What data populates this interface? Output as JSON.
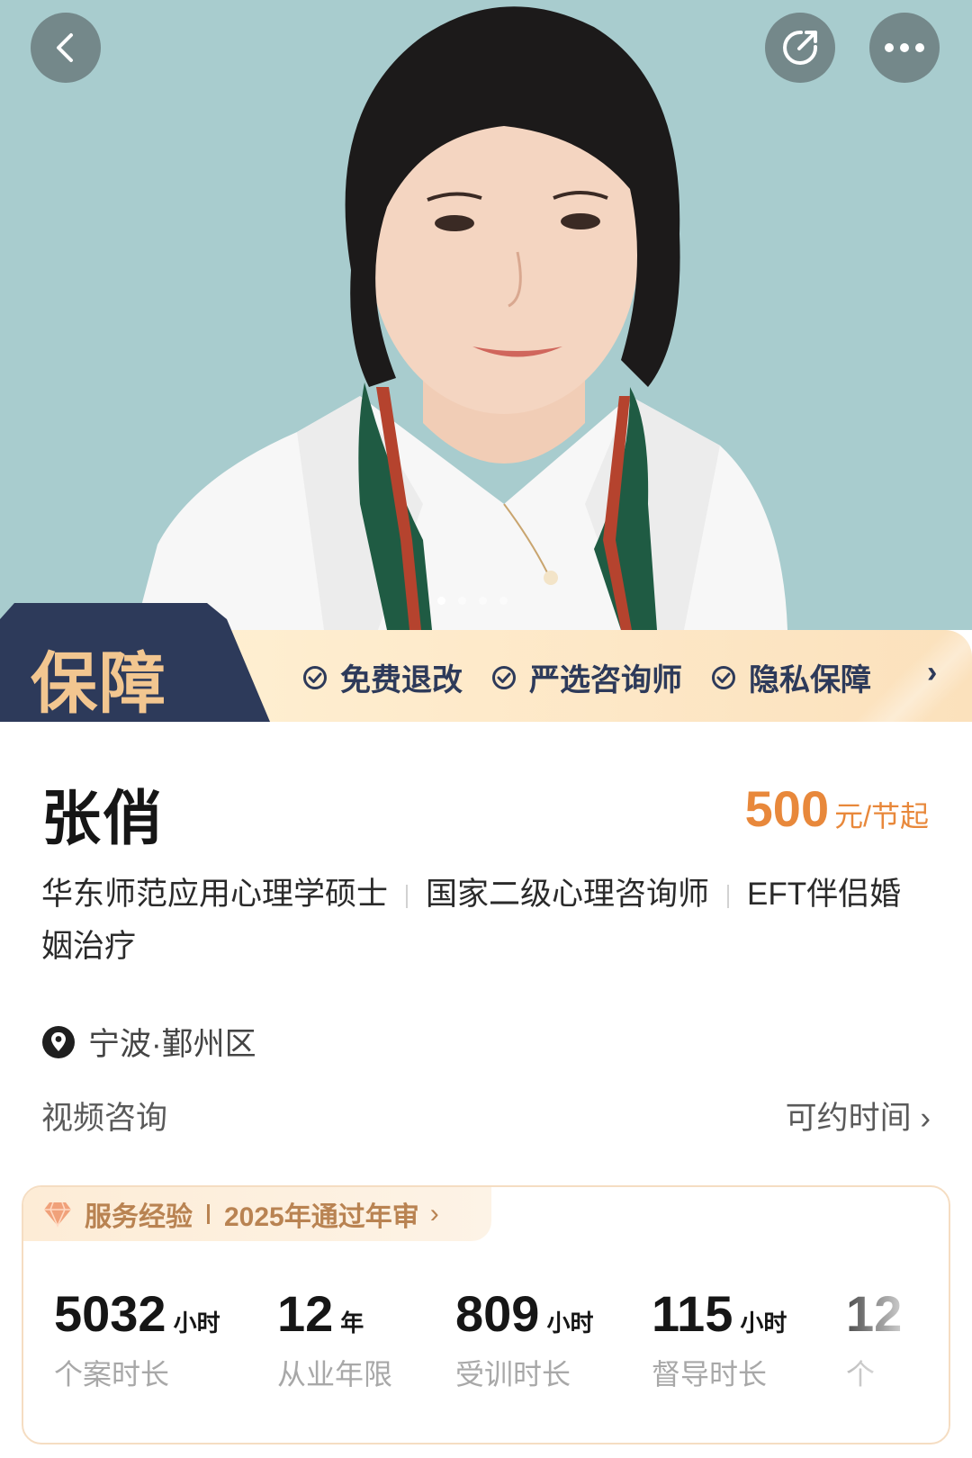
{
  "header": {
    "back_icon": "chevron-left-icon",
    "share_icon": "share-icon",
    "more_icon": "more-dots-icon"
  },
  "carousel": {
    "count": 4,
    "active": 0
  },
  "guarantee": {
    "brand": "保障",
    "items": [
      "免费退改",
      "严选咨询师",
      "隐私保障"
    ],
    "more": "›"
  },
  "profile": {
    "name": "张俏",
    "price_value": "500",
    "price_unit": "元/节起",
    "qualifications": [
      "华东师范应用心理学硕士",
      "国家二级心理咨询师",
      "EFT伴侣婚姻治疗"
    ],
    "location": "宁波·鄞州区",
    "consult_type": "视频咨询",
    "available_time": "可约时间 ›"
  },
  "experience": {
    "tab_title": "服务经验",
    "tab_subtitle": "2025年通过年审",
    "tab_chevron": "›",
    "stats": [
      {
        "value": "5032",
        "unit": "小时",
        "label": "个案时长"
      },
      {
        "value": "12",
        "unit": "年",
        "label": "从业年限"
      },
      {
        "value": "809",
        "unit": "小时",
        "label": "受训时长"
      },
      {
        "value": "115",
        "unit": "小时",
        "label": "督导时长"
      },
      {
        "value": "12",
        "unit": "",
        "label": "个"
      }
    ]
  },
  "colors": {
    "accent": "#e8883b",
    "navy": "#2d3a5a",
    "hero_bg": "#a8ccce",
    "gold": "#b98352"
  }
}
